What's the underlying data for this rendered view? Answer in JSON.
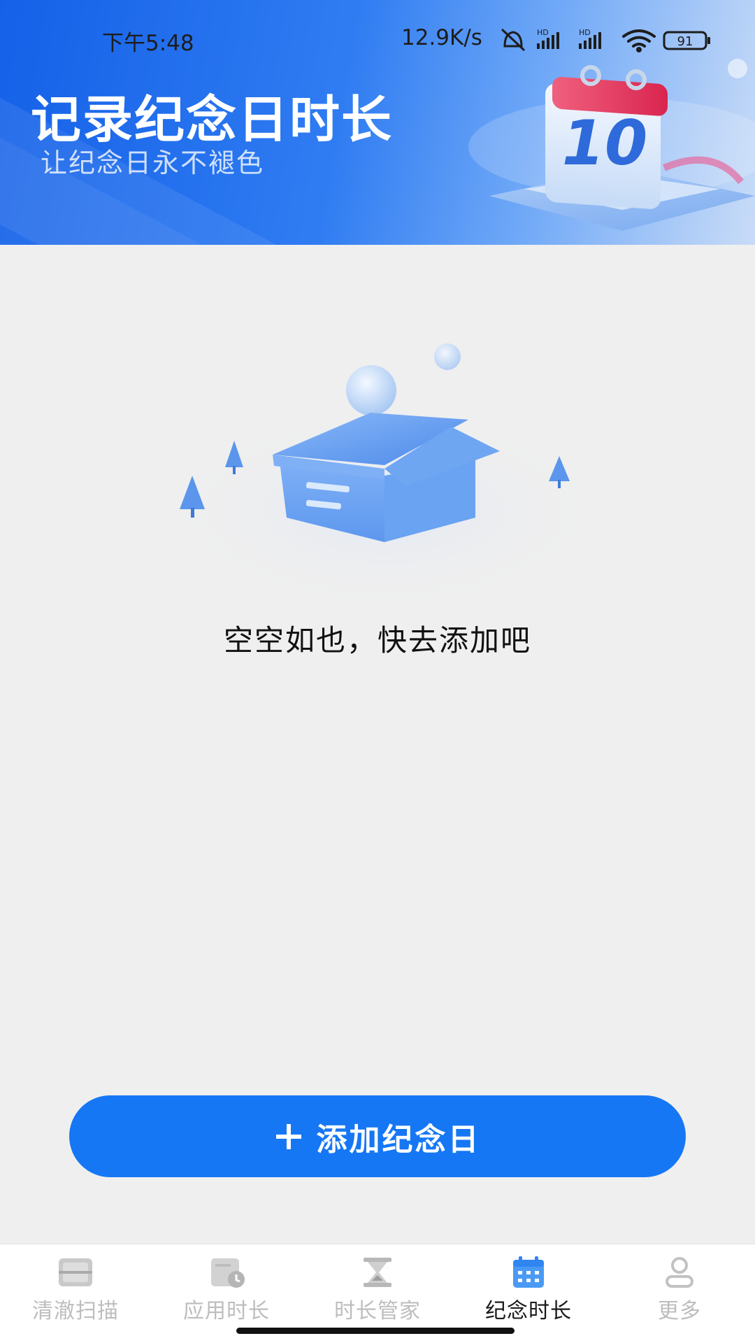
{
  "status_bar": {
    "time": "下午5:48",
    "net_speed": "12.9K/s",
    "battery": "91"
  },
  "banner": {
    "title": "记录纪念日时长",
    "subtitle": "让纪念日永不褪色",
    "calendar_number": "10"
  },
  "empty_state": {
    "message": "空空如也，快去添加吧"
  },
  "add_button": {
    "icon": "plus-icon",
    "label": "添加纪念日"
  },
  "bottom_nav": {
    "items": [
      {
        "label": "清澈扫描",
        "icon": "scan-icon",
        "active": false
      },
      {
        "label": "应用时长",
        "icon": "app-usage-icon",
        "active": false
      },
      {
        "label": "时长管家",
        "icon": "hourglass-icon",
        "active": false
      },
      {
        "label": "纪念时长",
        "icon": "calendar-icon",
        "active": true
      },
      {
        "label": "更多",
        "icon": "person-icon",
        "active": false
      }
    ]
  },
  "colors": {
    "accent": "#1677f5",
    "nav_inactive": "#bdbdbd",
    "nav_active_icon": "#4a9af5",
    "background": "#efefef"
  }
}
